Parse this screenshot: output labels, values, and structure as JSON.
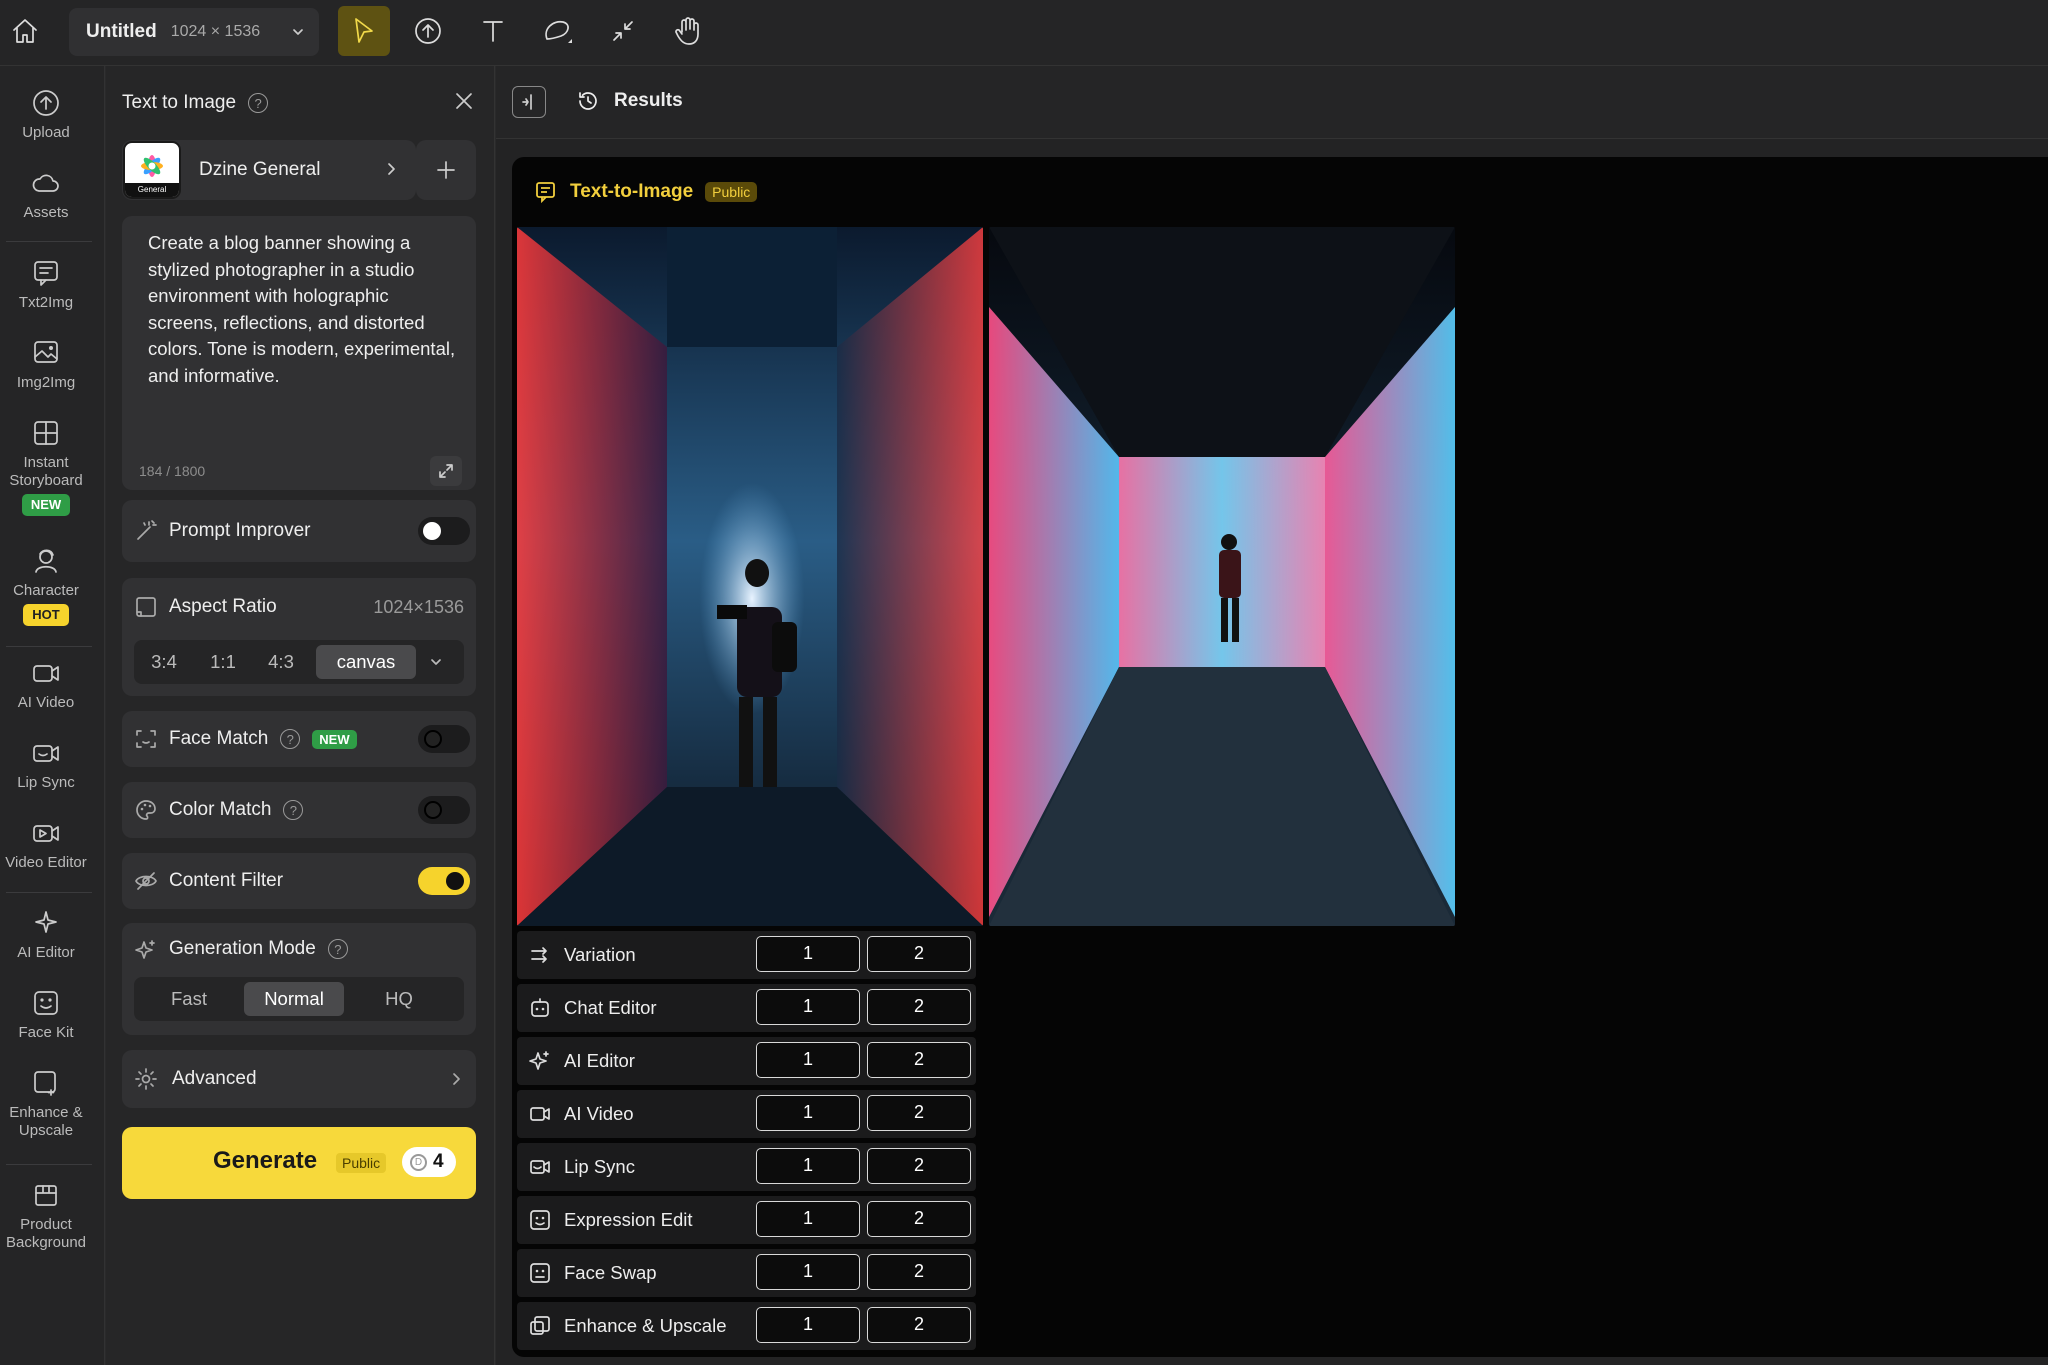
{
  "topbar": {
    "doc_name": "Untitled",
    "doc_size": "1024 × 1536",
    "tools": [
      "home-icon",
      "select-arrow-icon",
      "upload-icon",
      "text-tool-icon",
      "lasso-icon",
      "shrink-icon",
      "hand-icon"
    ],
    "active_tool": "select-arrow-icon"
  },
  "rail": [
    {
      "id": "upload",
      "label": "Upload",
      "icon": "upload-icon"
    },
    {
      "id": "assets",
      "label": "Assets",
      "icon": "cloud-icon"
    },
    {
      "id": "txt2img",
      "label": "Txt2Img",
      "icon": "txt2img-icon"
    },
    {
      "id": "img2img",
      "label": "Img2Img",
      "icon": "img2img-icon"
    },
    {
      "id": "storyboard",
      "label": "Instant Storyboard",
      "icon": "storyboard-icon",
      "badge": "NEW"
    },
    {
      "id": "character",
      "label": "Character",
      "icon": "character-icon",
      "badge": "HOT"
    },
    {
      "id": "ai-video",
      "label": "AI Video",
      "icon": "video-icon"
    },
    {
      "id": "lip-sync",
      "label": "Lip Sync",
      "icon": "lip-sync-icon"
    },
    {
      "id": "video-editor",
      "label": "Video Editor",
      "icon": "video-editor-icon"
    },
    {
      "id": "ai-editor",
      "label": "AI Editor",
      "icon": "sparkle-icon"
    },
    {
      "id": "face-kit",
      "label": "Face Kit",
      "icon": "face-kit-icon"
    },
    {
      "id": "enhance",
      "label": "Enhance & Upscale",
      "icon": "enhance-icon"
    },
    {
      "id": "product-bg",
      "label": "Product Background",
      "icon": "product-icon"
    }
  ],
  "panel": {
    "title": "Text to Image",
    "model": {
      "name": "Dzine General",
      "thumb_label": "General"
    },
    "prompt": "Create a blog banner showing a stylized photographer in a studio environment with holographic screens, reflections, and distorted colors. Tone is modern, experimental, and informative.",
    "prompt_count": "184 / 1800",
    "prompt_improver": {
      "label": "Prompt Improver",
      "enabled": false
    },
    "aspect_ratio": {
      "label": "Aspect Ratio",
      "value": "1024×1536",
      "options": [
        "3:4",
        "1:1",
        "4:3",
        "canvas"
      ],
      "selected": "canvas"
    },
    "face_match": {
      "label": "Face Match",
      "badge": "NEW",
      "enabled": false
    },
    "color_match": {
      "label": "Color Match",
      "enabled": false
    },
    "content_filter": {
      "label": "Content Filter",
      "enabled": true
    },
    "generation_mode": {
      "label": "Generation Mode",
      "options": [
        "Fast",
        "Normal",
        "HQ"
      ],
      "selected": "Normal"
    },
    "advanced": {
      "label": "Advanced"
    },
    "generate": {
      "label": "Generate",
      "badge": "Public",
      "cost": "4"
    }
  },
  "main": {
    "results_label": "Results",
    "result_title": "Text-to-Image",
    "result_badge": "Public",
    "actions": [
      {
        "label": "Variation",
        "icon": "variation-icon",
        "b1": "1",
        "b2": "2"
      },
      {
        "label": "Chat Editor",
        "icon": "chat-editor-icon",
        "b1": "1",
        "b2": "2"
      },
      {
        "label": "AI Editor",
        "icon": "sparkle-icon",
        "b1": "1",
        "b2": "2"
      },
      {
        "label": "AI Video",
        "icon": "video-icon",
        "b1": "1",
        "b2": "2"
      },
      {
        "label": "Lip Sync",
        "icon": "lip-sync-icon",
        "b1": "1",
        "b2": "2"
      },
      {
        "label": "Expression Edit",
        "icon": "expression-icon",
        "b1": "1",
        "b2": "2"
      },
      {
        "label": "Face Swap",
        "icon": "face-swap-icon",
        "b1": "1",
        "b2": "2"
      },
      {
        "label": "Enhance & Upscale",
        "icon": "enhance-icon",
        "b1": "1",
        "b2": "2"
      }
    ]
  },
  "colors": {
    "accent": "#f7d93b",
    "new_badge": "#2f9d46",
    "hot_badge": "#f6d32c",
    "background": "#2a2a2b"
  }
}
